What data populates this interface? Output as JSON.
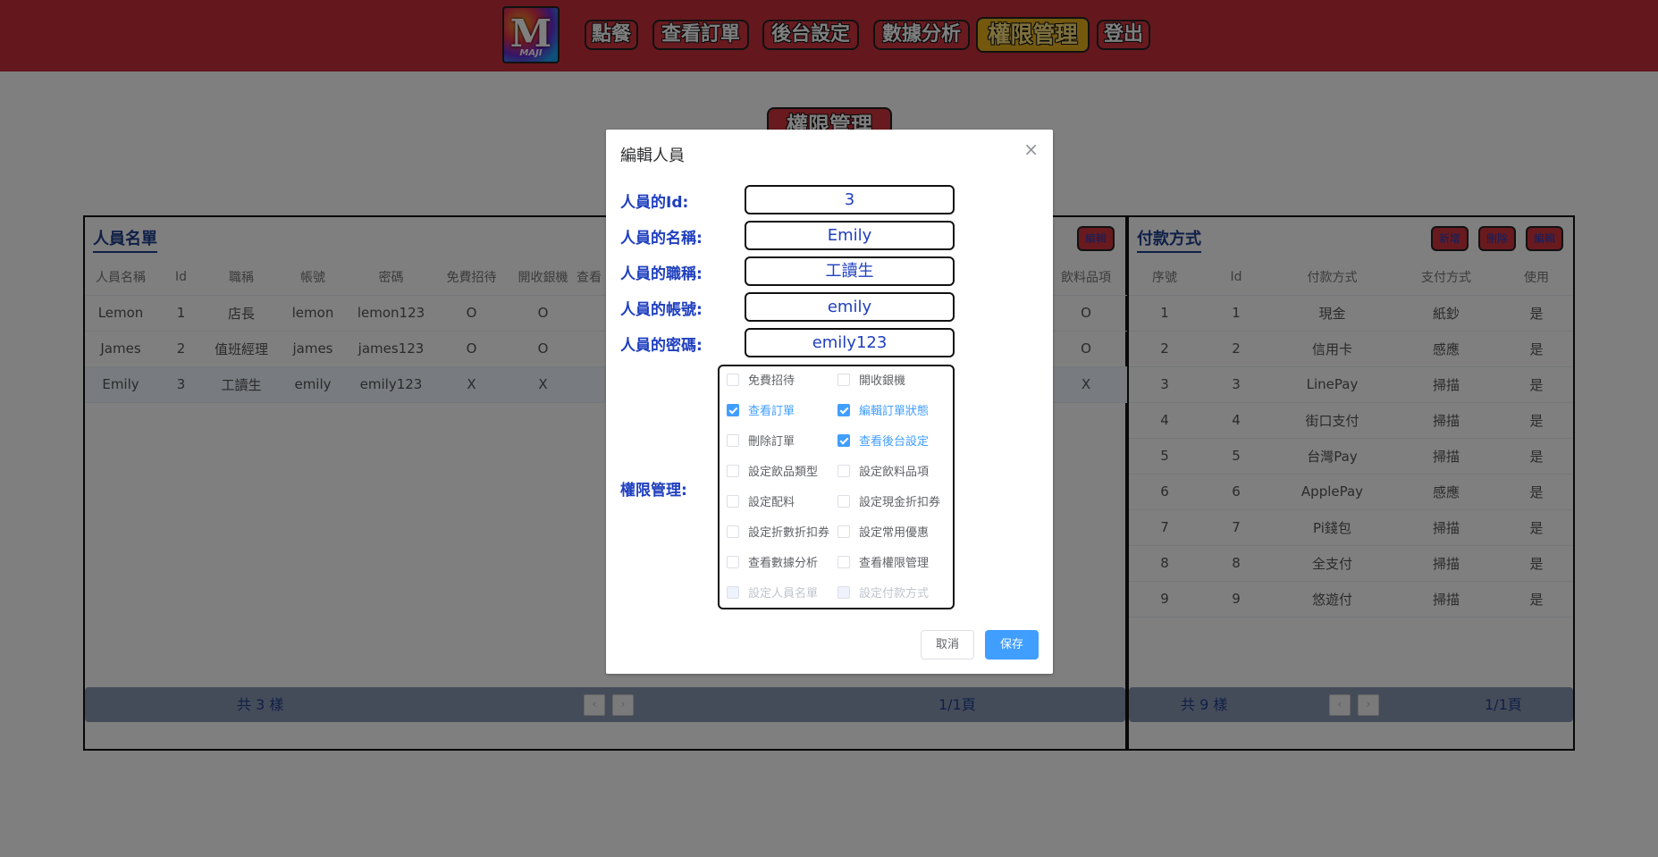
{
  "nav": {
    "logo_text": "M",
    "logo_sub": "MAJI",
    "buttons": [
      "點餐",
      "查看訂單",
      "後台設定",
      "數據分析",
      "權限管理",
      "登出"
    ]
  },
  "page": {
    "title": "權限管理"
  },
  "staff_panel": {
    "title": "人員名單",
    "tool_label": "編輯",
    "columns": [
      "人員名稱",
      "Id",
      "職稱",
      "帳號",
      "密碼",
      "免費招待",
      "開收銀機",
      "查看",
      "飲料品項"
    ],
    "rows": [
      [
        "Lemon",
        "1",
        "店長",
        "lemon",
        "lemon123",
        "O",
        "O",
        "O"
      ],
      [
        "James",
        "2",
        "值班經理",
        "james",
        "james123",
        "O",
        "O",
        "O"
      ],
      [
        "Emily",
        "3",
        "工讀生",
        "emily",
        "emily123",
        "X",
        "X",
        "X"
      ]
    ],
    "total": "共 3 樣",
    "page_info": "1/1頁"
  },
  "payment_panel": {
    "title": "付款方式",
    "tools": [
      "新增",
      "刪除",
      "編輯"
    ],
    "columns": [
      "序號",
      "Id",
      "付款方式",
      "支付方式",
      "使用"
    ],
    "rows": [
      [
        "1",
        "1",
        "現金",
        "紙鈔",
        "是"
      ],
      [
        "2",
        "2",
        "信用卡",
        "感應",
        "是"
      ],
      [
        "3",
        "3",
        "LinePay",
        "掃描",
        "是"
      ],
      [
        "4",
        "4",
        "街口支付",
        "掃描",
        "是"
      ],
      [
        "5",
        "5",
        "台灣Pay",
        "掃描",
        "是"
      ],
      [
        "6",
        "6",
        "ApplePay",
        "感應",
        "是"
      ],
      [
        "7",
        "7",
        "Pi錢包",
        "掃描",
        "是"
      ],
      [
        "8",
        "8",
        "全支付",
        "掃描",
        "是"
      ],
      [
        "9",
        "9",
        "悠遊付",
        "掃描",
        "是"
      ]
    ],
    "total": "共 9 樣",
    "page_info": "1/1頁"
  },
  "dialog": {
    "title": "編輯人員",
    "close": "×",
    "fields": [
      {
        "label": "人員的Id:",
        "value": "3"
      },
      {
        "label": "人員的名稱:",
        "value": "Emily"
      },
      {
        "label": "人員的職稱:",
        "value": "工讀生"
      },
      {
        "label": "人員的帳號:",
        "value": "emily"
      },
      {
        "label": "人員的密碼:",
        "value": "emily123"
      }
    ],
    "perm_label": "權限管理:",
    "permissions": [
      {
        "label": "免費招待",
        "checked": false,
        "disabled": false
      },
      {
        "label": "開收銀機",
        "checked": false,
        "disabled": false
      },
      {
        "label": "查看訂單",
        "checked": true,
        "disabled": false
      },
      {
        "label": "編輯訂單狀態",
        "checked": true,
        "disabled": false
      },
      {
        "label": "刪除訂單",
        "checked": false,
        "disabled": false
      },
      {
        "label": "查看後台設定",
        "checked": true,
        "disabled": false
      },
      {
        "label": "設定飲品類型",
        "checked": false,
        "disabled": false
      },
      {
        "label": "設定飲料品項",
        "checked": false,
        "disabled": false
      },
      {
        "label": "設定配料",
        "checked": false,
        "disabled": false
      },
      {
        "label": "設定現金折扣券",
        "checked": false,
        "disabled": false
      },
      {
        "label": "設定折數折扣券",
        "checked": false,
        "disabled": false
      },
      {
        "label": "設定常用優惠",
        "checked": false,
        "disabled": false
      },
      {
        "label": "查看數據分析",
        "checked": false,
        "disabled": false
      },
      {
        "label": "查看權限管理",
        "checked": false,
        "disabled": false
      },
      {
        "label": "設定人員名單",
        "checked": false,
        "disabled": true
      },
      {
        "label": "設定付款方式",
        "checked": false,
        "disabled": true
      }
    ],
    "cancel_label": "取消",
    "save_label": "保存"
  },
  "colors": {
    "nav_bg": "#c8303a",
    "accent_blue": "#1f3fbf",
    "primary": "#409eff",
    "active_nav": "#e6b11c"
  }
}
